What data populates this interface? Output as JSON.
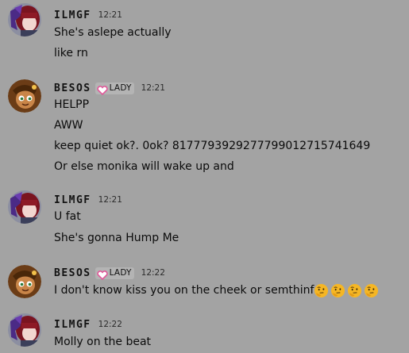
{
  "messages": [
    {
      "author": "ILMGF",
      "author_tag": null,
      "avatar": "avatar-red-hair-purple-bow",
      "time": "12:21",
      "lines": [
        "She's aslepe actually",
        "like rn"
      ],
      "emojis": []
    },
    {
      "author": "BESOS",
      "author_tag": "LADY",
      "avatar": "avatar-brown-hair-character",
      "time": "12:21",
      "lines": [
        "HELPP",
        "AWW",
        "keep quiet ok?. 0ok? 8177793929277799012715741649",
        "Or else monika will wake up and"
      ],
      "emojis": []
    },
    {
      "author": "ILMGF",
      "author_tag": null,
      "avatar": "avatar-red-hair-purple-bow",
      "time": "12:21",
      "lines": [
        "U fat",
        "She's gonna Hump Me"
      ],
      "emojis": []
    },
    {
      "author": "BESOS",
      "author_tag": "LADY",
      "avatar": "avatar-brown-hair-character",
      "time": "12:22",
      "lines": [
        "I don't know kiss you on the cheek or semthinf"
      ],
      "emojis": [
        "thinking-face-emoji",
        "thinking-face-emoji",
        "thinking-face-emoji",
        "thinking-face-emoji"
      ]
    },
    {
      "author": "ILMGF",
      "author_tag": null,
      "avatar": "avatar-red-hair-purple-bow",
      "time": "12:22",
      "lines": [
        "Molly on the beat"
      ],
      "emojis": []
    }
  ],
  "colors": {
    "background": "#a3a3a3",
    "tag_background": "#b4b4b4",
    "tag_heart": "#e05a9a",
    "text": "#0b0b0b",
    "timestamp": "#2b2b2b"
  }
}
